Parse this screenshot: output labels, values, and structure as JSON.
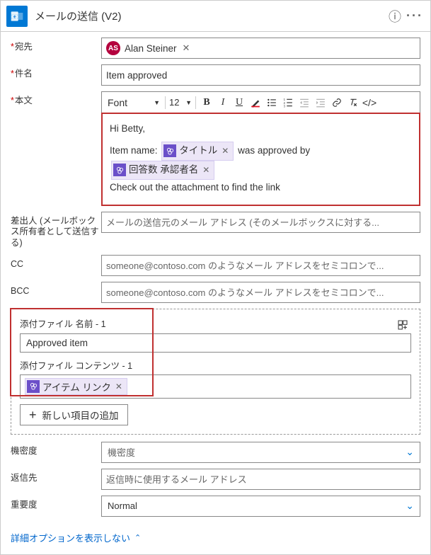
{
  "header": {
    "title": "メールの送信 (V2)"
  },
  "to": {
    "label": "宛先",
    "recipient_initials": "AS",
    "recipient_name": "Alan Steiner"
  },
  "subject": {
    "label": "件名",
    "value": "Item approved"
  },
  "body": {
    "label": "本文",
    "font_label": "Font",
    "font_size": "12",
    "greeting": "Hi Betty,",
    "line2_pre": "Item name:",
    "token_title": "タイトル",
    "line2_post": "was approved by",
    "token_approver": "回答数 承認者名",
    "line4": "Check out the attachment to find the link"
  },
  "from": {
    "label": "差出人 (メールボックス所有者として送信する)",
    "placeholder": "メールの送信元のメール アドレス (そのメールボックスに対する..."
  },
  "cc": {
    "label": "CC",
    "placeholder": "someone@contoso.com のようなメール アドレスをセミコロンで..."
  },
  "bcc": {
    "label": "BCC",
    "placeholder": "someone@contoso.com のようなメール アドレスをセミコロンで..."
  },
  "attach": {
    "name_label": "添付ファイル 名前 - 1",
    "name_value": "Approved item",
    "content_label": "添付ファイル コンテンツ - 1",
    "content_token": "アイテム リンク",
    "add_button": "新しい項目の追加"
  },
  "sensitivity": {
    "label": "機密度",
    "placeholder": "機密度"
  },
  "reply_to": {
    "label": "返信先",
    "placeholder": "返信時に使用するメール アドレス"
  },
  "importance": {
    "label": "重要度",
    "value": "Normal"
  },
  "footer": {
    "link": "詳細オプションを表示しない"
  }
}
